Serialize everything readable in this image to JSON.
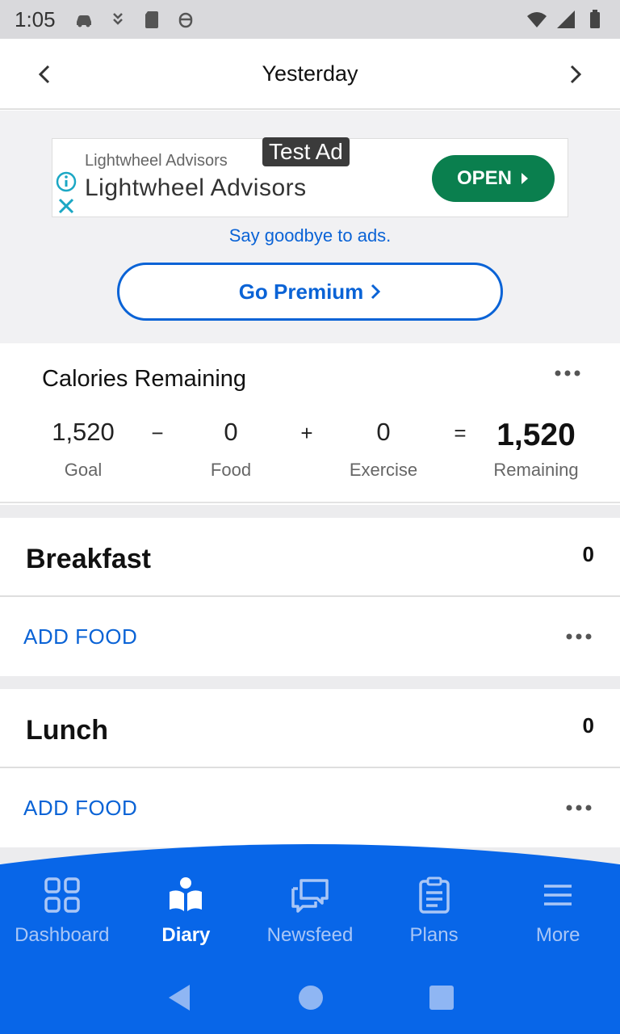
{
  "status_bar": {
    "time": "1:05"
  },
  "header": {
    "title": "Yesterday"
  },
  "ad": {
    "advertiser_small": "Lightwheel Advisors",
    "advertiser_big": "Lightwheel Advisors",
    "test_badge": "Test Ad",
    "open_label": "OPEN",
    "goodbye_text": "Say goodbye to ads.",
    "premium_label": "Go Premium"
  },
  "calories": {
    "title": "Calories Remaining",
    "goal": {
      "value": "1,520",
      "label": "Goal"
    },
    "minus": "−",
    "food": {
      "value": "0",
      "label": "Food"
    },
    "plus": "+",
    "exercise": {
      "value": "0",
      "label": "Exercise"
    },
    "equals": "=",
    "remaining": {
      "value": "1,520",
      "label": "Remaining"
    }
  },
  "meals": [
    {
      "name": "Breakfast",
      "calories": "0",
      "add_label": "ADD FOOD"
    },
    {
      "name": "Lunch",
      "calories": "0",
      "add_label": "ADD FOOD"
    }
  ],
  "tabs": [
    {
      "label": "Dashboard",
      "icon": "dashboard-icon"
    },
    {
      "label": "Diary",
      "icon": "diary-icon",
      "active": true
    },
    {
      "label": "Newsfeed",
      "icon": "newsfeed-icon"
    },
    {
      "label": "Plans",
      "icon": "plans-icon"
    },
    {
      "label": "More",
      "icon": "menu-icon"
    }
  ],
  "colors": {
    "brand_blue": "#0866E8",
    "link_blue": "#0A63D6",
    "ad_green": "#0A7F4E"
  }
}
